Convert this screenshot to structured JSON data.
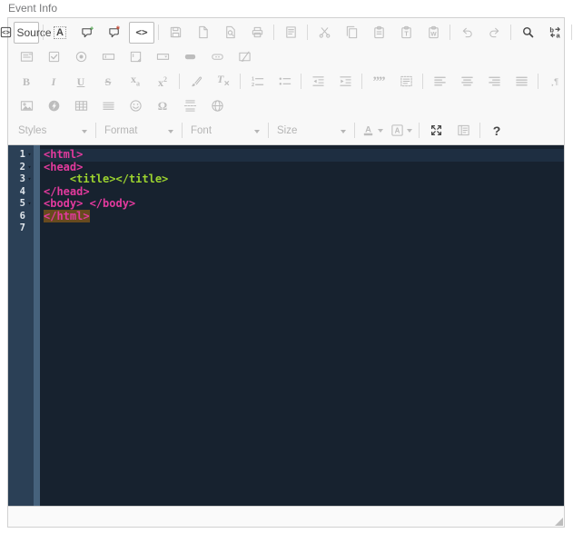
{
  "field_label": "Event Info",
  "editor": {
    "colors": {
      "tag": "#e23a9d",
      "tag2": "#9cd32f",
      "code_bg": "#17222f",
      "gutter_bg": "#2b4056",
      "fold_strip": "#46627c",
      "active_line": "#1e2e41",
      "match_bg": "rgba(255,150,0,0.35)",
      "toolbar_bg": "#f8f8f8",
      "border": "#d1d1d1"
    },
    "toolbar": {
      "rows": [
        {
          "items": [
            {
              "kind": "button",
              "name": "source",
              "icon": "source",
              "label": "Source",
              "state": "on"
            },
            {
              "kind": "sep"
            },
            {
              "kind": "button",
              "name": "auto-format",
              "icon": "auto-format",
              "state": "enabled"
            },
            {
              "kind": "button",
              "name": "comment-range",
              "icon": "comment-add",
              "state": "enabled"
            },
            {
              "kind": "button",
              "name": "uncomment-range",
              "icon": "comment-remove",
              "state": "enabled"
            },
            {
              "kind": "button",
              "name": "autocomplete",
              "icon": "autocomplete",
              "state": "on"
            },
            {
              "kind": "sep"
            },
            {
              "kind": "button",
              "name": "save",
              "icon": "save",
              "state": "disabled"
            },
            {
              "kind": "button",
              "name": "new-page",
              "icon": "new-page",
              "state": "disabled"
            },
            {
              "kind": "button",
              "name": "preview",
              "icon": "preview",
              "state": "disabled"
            },
            {
              "kind": "button",
              "name": "print",
              "icon": "print",
              "state": "disabled"
            },
            {
              "kind": "sep"
            },
            {
              "kind": "button",
              "name": "templates",
              "icon": "templates",
              "state": "disabled"
            },
            {
              "kind": "sep"
            },
            {
              "kind": "button",
              "name": "cut",
              "icon": "cut",
              "state": "disabled"
            },
            {
              "kind": "button",
              "name": "copy",
              "icon": "copy",
              "state": "disabled"
            },
            {
              "kind": "button",
              "name": "paste",
              "icon": "paste",
              "state": "disabled"
            },
            {
              "kind": "button",
              "name": "paste-text",
              "icon": "paste-text",
              "state": "disabled"
            },
            {
              "kind": "button",
              "name": "paste-from-word",
              "icon": "paste-word",
              "state": "disabled"
            },
            {
              "kind": "sep"
            },
            {
              "kind": "button",
              "name": "undo",
              "icon": "undo",
              "state": "disabled"
            },
            {
              "kind": "button",
              "name": "redo",
              "icon": "redo",
              "state": "disabled"
            },
            {
              "kind": "sep"
            },
            {
              "kind": "button",
              "name": "find",
              "icon": "find",
              "state": "enabled"
            },
            {
              "kind": "button",
              "name": "replace",
              "icon": "replace",
              "state": "enabled"
            },
            {
              "kind": "sep"
            },
            {
              "kind": "button",
              "name": "select-all",
              "icon": "select-all",
              "state": "enabled"
            },
            {
              "kind": "sep"
            },
            {
              "kind": "button",
              "name": "spell-checker",
              "icon": "spellcheck",
              "state": "disabled",
              "arrow": true
            },
            {
              "kind": "sep"
            }
          ]
        },
        {
          "items": [
            {
              "kind": "button",
              "name": "form",
              "icon": "form",
              "state": "disabled"
            },
            {
              "kind": "button",
              "name": "checkbox",
              "icon": "checkbox",
              "state": "disabled"
            },
            {
              "kind": "button",
              "name": "radio-button",
              "icon": "radio",
              "state": "disabled"
            },
            {
              "kind": "button",
              "name": "text-field",
              "icon": "text-field",
              "state": "disabled"
            },
            {
              "kind": "button",
              "name": "textarea",
              "icon": "textarea",
              "state": "disabled"
            },
            {
              "kind": "button",
              "name": "selection-field",
              "icon": "select-field",
              "state": "disabled"
            },
            {
              "kind": "button",
              "name": "button-element",
              "icon": "button-el",
              "state": "disabled"
            },
            {
              "kind": "button",
              "name": "image-button",
              "icon": "image-button",
              "state": "disabled"
            },
            {
              "kind": "button",
              "name": "hidden-field",
              "icon": "hidden-field",
              "state": "disabled"
            }
          ]
        },
        {
          "items": [
            {
              "kind": "button",
              "name": "bold",
              "icon": "bold",
              "state": "disabled"
            },
            {
              "kind": "button",
              "name": "italic",
              "icon": "italic",
              "state": "disabled"
            },
            {
              "kind": "button",
              "name": "underline",
              "icon": "underline",
              "state": "disabled"
            },
            {
              "kind": "button",
              "name": "strikethrough",
              "icon": "strike",
              "state": "disabled"
            },
            {
              "kind": "button",
              "name": "subscript",
              "icon": "subscript",
              "state": "disabled"
            },
            {
              "kind": "button",
              "name": "superscript",
              "icon": "superscript",
              "state": "disabled"
            },
            {
              "kind": "sep"
            },
            {
              "kind": "button",
              "name": "copy-formatting",
              "icon": "copy-formatting",
              "state": "disabled"
            },
            {
              "kind": "button",
              "name": "remove-format",
              "icon": "remove-format",
              "state": "disabled"
            },
            {
              "kind": "sep"
            },
            {
              "kind": "button",
              "name": "numbered-list",
              "icon": "numbered-list",
              "state": "disabled"
            },
            {
              "kind": "button",
              "name": "bulleted-list",
              "icon": "bulleted-list",
              "state": "disabled"
            },
            {
              "kind": "sep"
            },
            {
              "kind": "button",
              "name": "outdent",
              "icon": "outdent",
              "state": "disabled"
            },
            {
              "kind": "button",
              "name": "indent",
              "icon": "indent",
              "state": "disabled"
            },
            {
              "kind": "sep"
            },
            {
              "kind": "button",
              "name": "blockquote",
              "icon": "blockquote",
              "state": "disabled"
            },
            {
              "kind": "button",
              "name": "div-container",
              "icon": "div-container",
              "state": "disabled"
            },
            {
              "kind": "sep"
            },
            {
              "kind": "button",
              "name": "align-left",
              "icon": "align-left",
              "state": "disabled"
            },
            {
              "kind": "button",
              "name": "align-center",
              "icon": "align-center",
              "state": "disabled"
            },
            {
              "kind": "button",
              "name": "align-right",
              "icon": "align-right",
              "state": "disabled"
            },
            {
              "kind": "button",
              "name": "align-justify",
              "icon": "align-justify",
              "state": "disabled"
            },
            {
              "kind": "sep"
            },
            {
              "kind": "button",
              "name": "bidi-ltr",
              "icon": "bidi-ltr",
              "state": "disabled"
            },
            {
              "kind": "button",
              "name": "bidi-rtl",
              "icon": "bidi-rtl",
              "state": "disabled"
            },
            {
              "kind": "sep"
            },
            {
              "kind": "button",
              "name": "language",
              "icon": "language",
              "state": "disabled",
              "arrow": true
            },
            {
              "kind": "sep"
            },
            {
              "kind": "button",
              "name": "link",
              "icon": "link",
              "state": "disabled"
            },
            {
              "kind": "button",
              "name": "unlink",
              "icon": "unlink",
              "state": "disabled"
            },
            {
              "kind": "button",
              "name": "anchor",
              "icon": "anchor-flag",
              "state": "disabled"
            },
            {
              "kind": "sep"
            }
          ]
        },
        {
          "items": [
            {
              "kind": "button",
              "name": "image",
              "icon": "image",
              "state": "disabled"
            },
            {
              "kind": "button",
              "name": "flash",
              "icon": "flash",
              "state": "disabled"
            },
            {
              "kind": "button",
              "name": "table",
              "icon": "table",
              "state": "disabled"
            },
            {
              "kind": "button",
              "name": "horizontal-rule",
              "icon": "horizontal-rule",
              "state": "disabled"
            },
            {
              "kind": "button",
              "name": "smiley",
              "icon": "smiley",
              "state": "disabled"
            },
            {
              "kind": "button",
              "name": "special-character",
              "icon": "special-char",
              "state": "disabled"
            },
            {
              "kind": "button",
              "name": "page-break",
              "icon": "page-break",
              "state": "disabled"
            },
            {
              "kind": "button",
              "name": "iframe",
              "icon": "iframe-globe",
              "state": "disabled"
            }
          ]
        },
        {
          "items": [
            {
              "kind": "combo",
              "name": "styles",
              "label": "Styles",
              "state": "disabled"
            },
            {
              "kind": "sep"
            },
            {
              "kind": "combo",
              "name": "format",
              "label": "Format",
              "state": "disabled"
            },
            {
              "kind": "sep"
            },
            {
              "kind": "combo",
              "name": "font",
              "label": "Font",
              "state": "disabled"
            },
            {
              "kind": "sep"
            },
            {
              "kind": "combo",
              "name": "size",
              "label": "Size",
              "state": "disabled"
            },
            {
              "kind": "sep"
            },
            {
              "kind": "button",
              "name": "text-color",
              "icon": "text-color",
              "state": "disabled",
              "arrow": true
            },
            {
              "kind": "button",
              "name": "background-color",
              "icon": "bg-color",
              "state": "disabled",
              "arrow": true
            },
            {
              "kind": "sep"
            },
            {
              "kind": "button",
              "name": "maximize",
              "icon": "maximize",
              "state": "enabled"
            },
            {
              "kind": "button",
              "name": "show-blocks",
              "icon": "show-blocks",
              "state": "disabled"
            },
            {
              "kind": "sep"
            },
            {
              "kind": "button",
              "name": "about",
              "icon": "about",
              "state": "enabled"
            }
          ]
        }
      ]
    },
    "code": {
      "lines": [
        {
          "number": 1,
          "fold": true,
          "active": true,
          "segments": [
            {
              "t": "<html>",
              "c": "tag"
            }
          ]
        },
        {
          "number": 2,
          "fold": true,
          "segments": [
            {
              "t": "<head>",
              "c": "tag"
            }
          ]
        },
        {
          "number": 3,
          "fold": true,
          "segments": [
            {
              "t": "    ",
              "c": "plain"
            },
            {
              "t": "<title></title>",
              "c": "tag2"
            }
          ]
        },
        {
          "number": 4,
          "segments": [
            {
              "t": "</head>",
              "c": "tag"
            }
          ]
        },
        {
          "number": 5,
          "fold": true,
          "segments": [
            {
              "t": "<body> </body>",
              "c": "tag"
            }
          ]
        },
        {
          "number": 6,
          "segments": [
            {
              "t": "</html>",
              "c": "tag",
              "match": true
            }
          ]
        },
        {
          "number": 7,
          "segments": []
        }
      ]
    }
  }
}
